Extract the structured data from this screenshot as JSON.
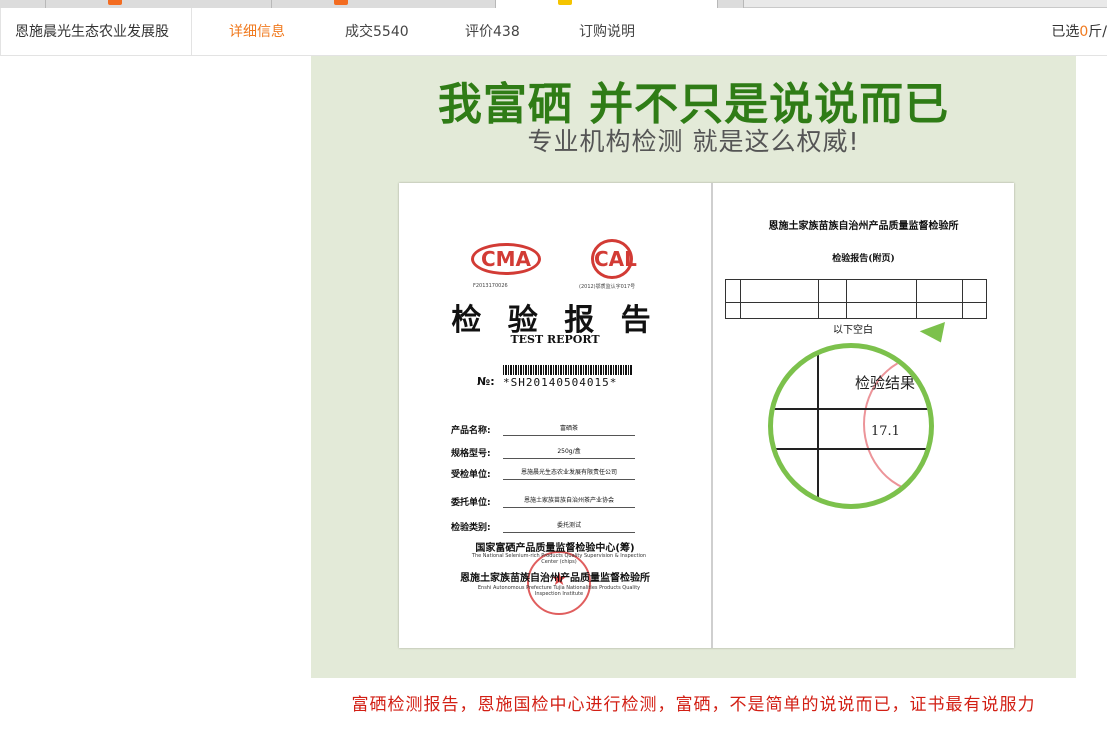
{
  "nav": {
    "shop_name": "恩施晨光生态农业发展股",
    "tabs": [
      {
        "label": "详细信息",
        "active": true
      },
      {
        "label": "成交5540",
        "active": false
      },
      {
        "label": "评价438",
        "active": false
      },
      {
        "label": "订购说明",
        "active": false
      }
    ],
    "selected_prefix": "已选",
    "selected_count": "0",
    "selected_unit": "斤/"
  },
  "banner": {
    "headline": "我富硒 并不只是说说而已",
    "subhead": "专业机构检测 就是这么权威!"
  },
  "certificate": {
    "logo_left": "CMA",
    "logo_right": "CAL",
    "logo_left_sub": "F2013170026",
    "logo_right_sub": "(2012)鄂质监认字017号",
    "title": "检 验 报 告",
    "title_en": "TEST REPORT",
    "no_label": "№:",
    "no_value": "*SH20140504015*",
    "fields": [
      {
        "label": "产品名称:",
        "value": "富硒茶"
      },
      {
        "label": "规格型号:",
        "value": "250g/盒"
      },
      {
        "label": "受检单位:",
        "value": "恩施晨光生态农业发展有限责任公司"
      },
      {
        "label": "委托单位:",
        "value": "恩施土家族苗族自治州茶产业协会"
      },
      {
        "label": "检验类别:",
        "value": "委托测试"
      }
    ],
    "issuer_1": "国家富硒产品质量监督检验中心(筹)",
    "issuer_1_en": "The National Selenium-rich Products Quality Supervision & Inspection Center (chips)",
    "issuer_2": "恩施土家族苗族自治州产品质量监督检验所",
    "issuer_2_en": "Enshi Autonomous Prefecture Tujia Nationalities Products Quality Inspection Institute",
    "right_institute": "恩施土家族苗族自治州产品质量监督检验所",
    "right_title": "检验报告(附页)",
    "right_blank": "以下空白",
    "zoom_header": "检验结果",
    "zoom_value": "17.1"
  },
  "caption": "富硒检测报告，恩施国检中心进行检测，富硒，不是简单的说说而已，证书最有说服力",
  "colors": {
    "accent_orange": "#f07a1f",
    "headline_green": "#2f7c16",
    "banner_bg": "#e3ead8",
    "caption_red": "#d21f14",
    "zoom_ring": "#7cc14c",
    "seal_red": "#d23b35"
  }
}
